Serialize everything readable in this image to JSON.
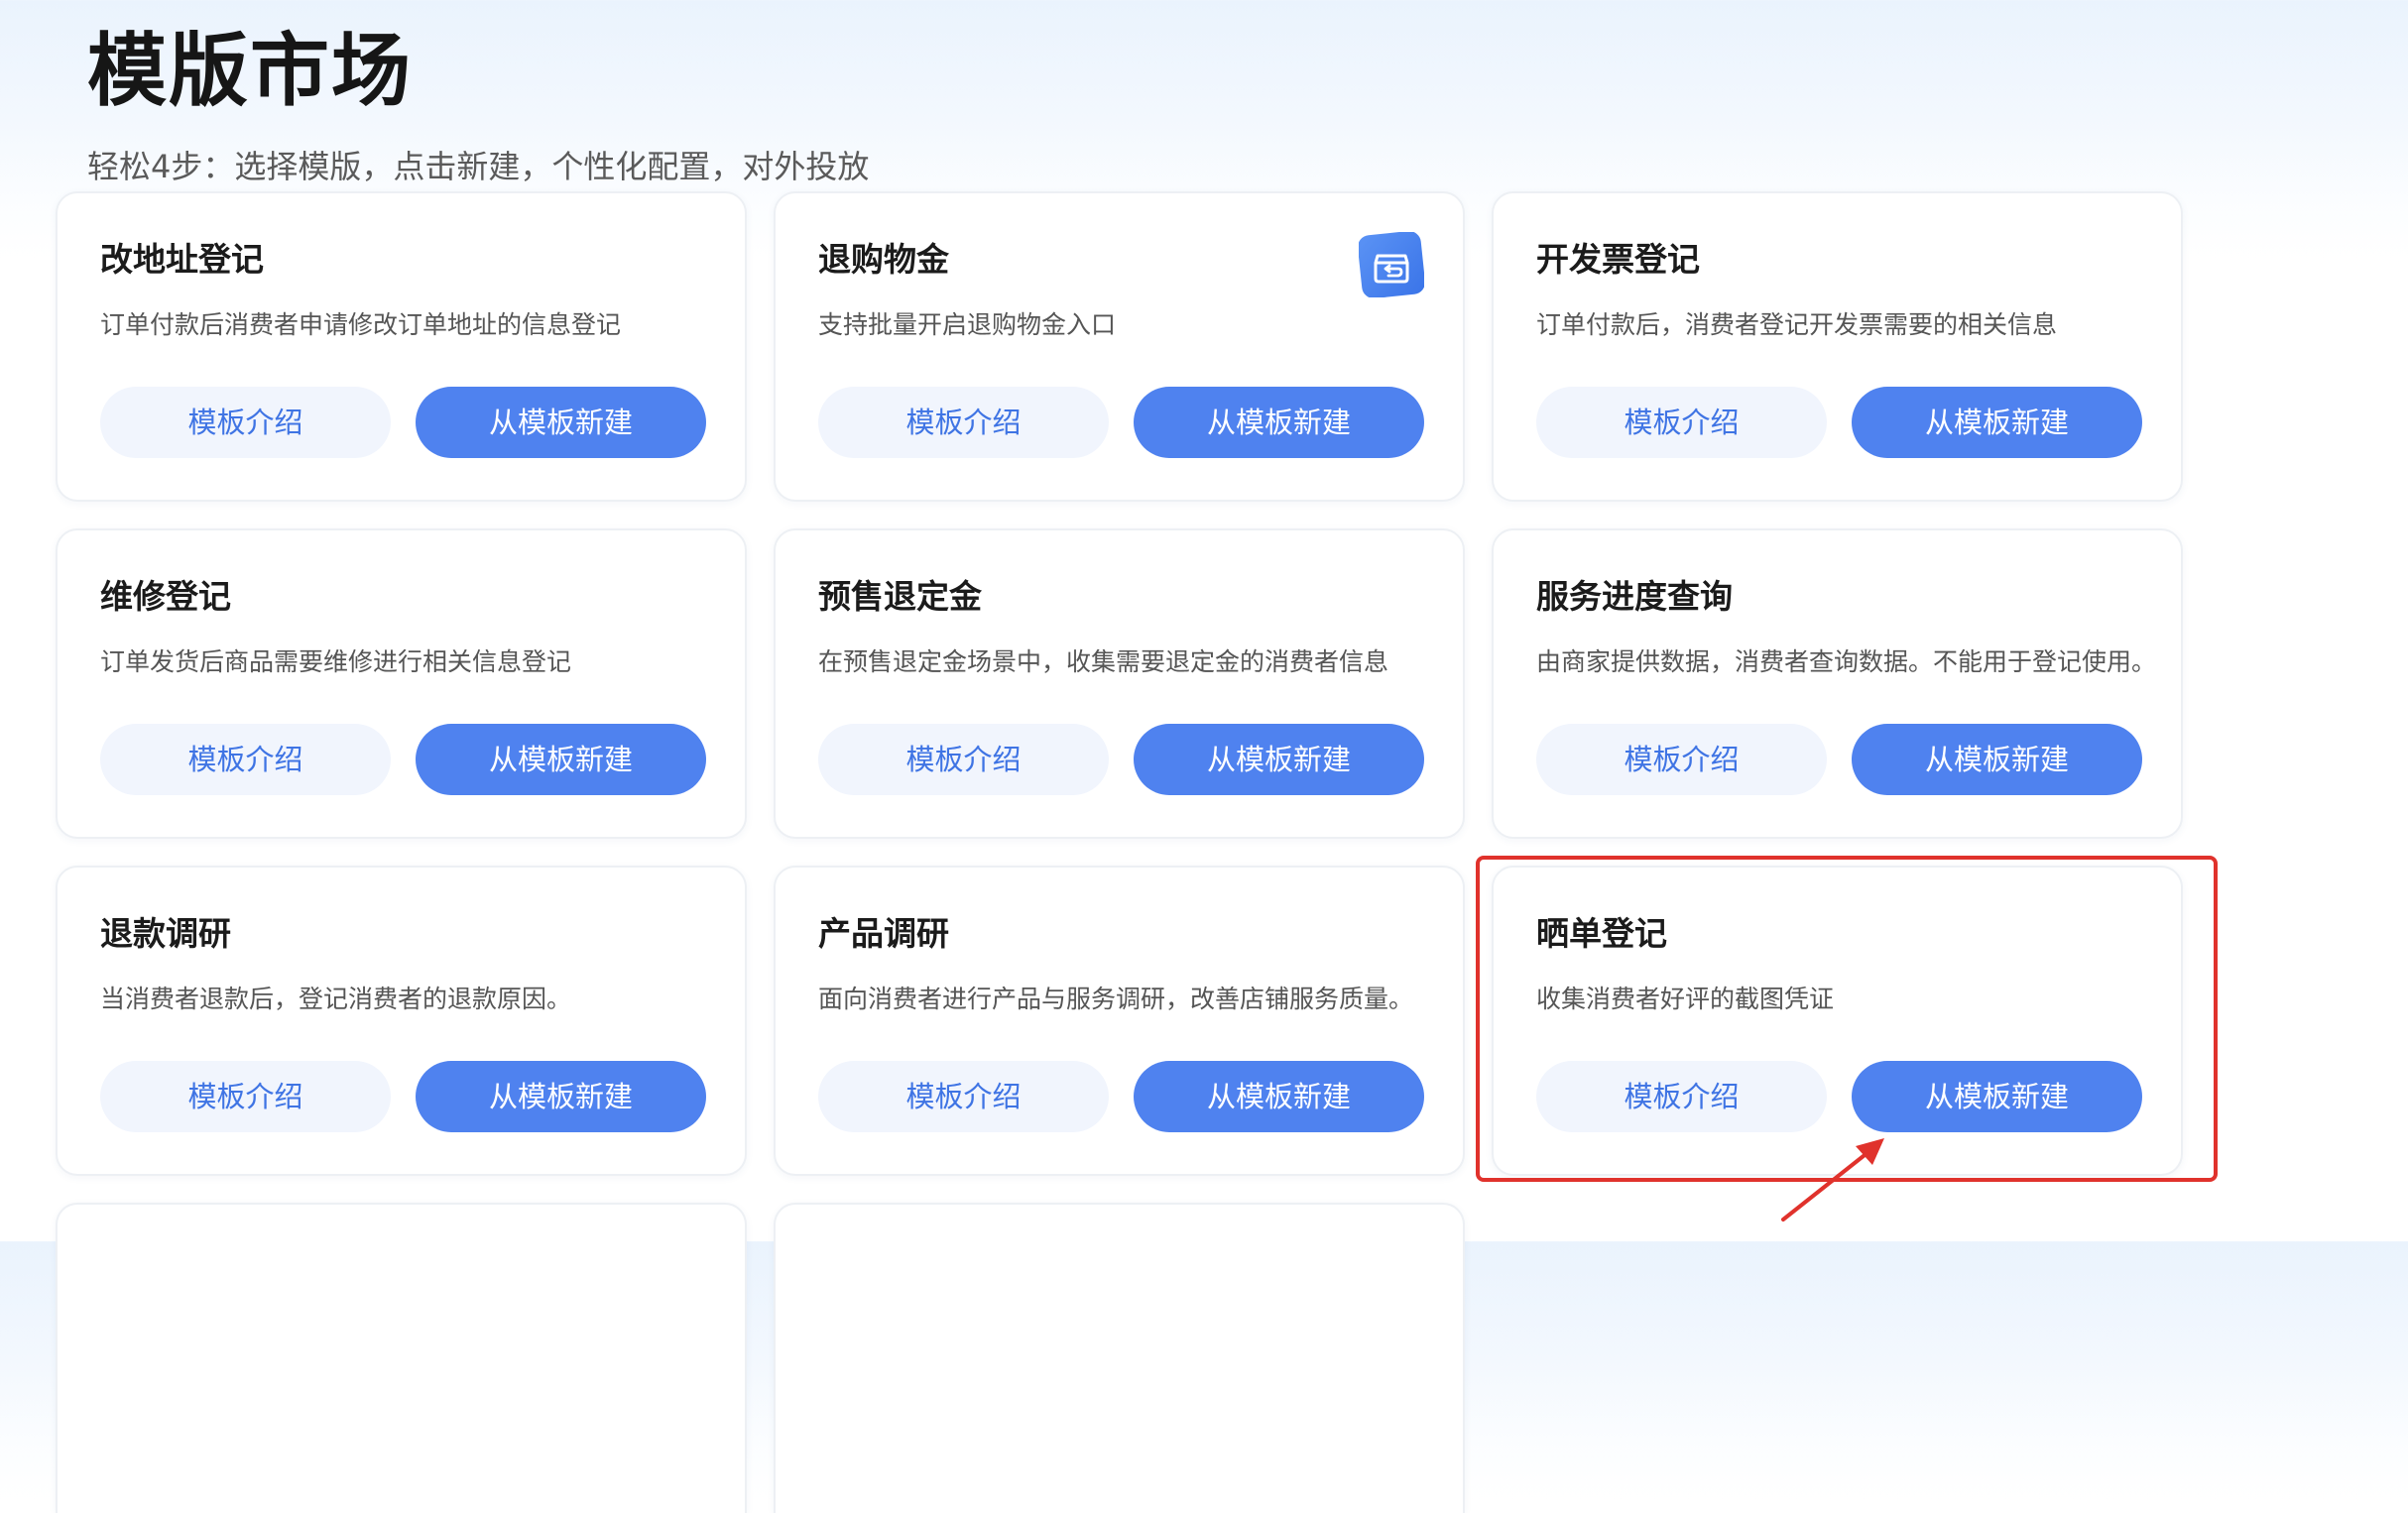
{
  "page": {
    "title": "模版市场",
    "subtitle": "轻松4步：选择模版，点击新建，个性化配置，对外投放"
  },
  "colors": {
    "primary": "#4f82ef",
    "primary_text_on_light": "#3f74e4",
    "intro_button_bg": "#f1f5fd",
    "annotation_red": "#e0322c"
  },
  "templates": [
    {
      "title": "改地址登记",
      "description": "订单付款后消费者申请修改订单地址的信息登记",
      "intro_label": "模板介绍",
      "create_label": "从模板新建"
    },
    {
      "title": "退购物金",
      "description": "支持批量开启退购物金入口",
      "intro_label": "模板介绍",
      "create_label": "从模板新建",
      "icon": "refund-box-icon"
    },
    {
      "title": "开发票登记",
      "description": "订单付款后，消费者登记开发票需要的相关信息",
      "intro_label": "模板介绍",
      "create_label": "从模板新建"
    },
    {
      "title": "维修登记",
      "description": "订单发货后商品需要维修进行相关信息登记",
      "intro_label": "模板介绍",
      "create_label": "从模板新建"
    },
    {
      "title": "预售退定金",
      "description": "在预售退定金场景中，收集需要退定金的消费者信息",
      "intro_label": "模板介绍",
      "create_label": "从模板新建"
    },
    {
      "title": "服务进度查询",
      "description": "由商家提供数据，消费者查询数据。不能用于登记使用。",
      "intro_label": "模板介绍",
      "create_label": "从模板新建"
    },
    {
      "title": "退款调研",
      "description": "当消费者退款后，登记消费者的退款原因。",
      "intro_label": "模板介绍",
      "create_label": "从模板新建"
    },
    {
      "title": "产品调研",
      "description": "面向消费者进行产品与服务调研，改善店铺服务质量。",
      "intro_label": "模板介绍",
      "create_label": "从模板新建"
    },
    {
      "title": "晒单登记",
      "description": "收集消费者好评的截图凭证",
      "intro_label": "模板介绍",
      "create_label": "从模板新建",
      "highlighted": true
    }
  ]
}
